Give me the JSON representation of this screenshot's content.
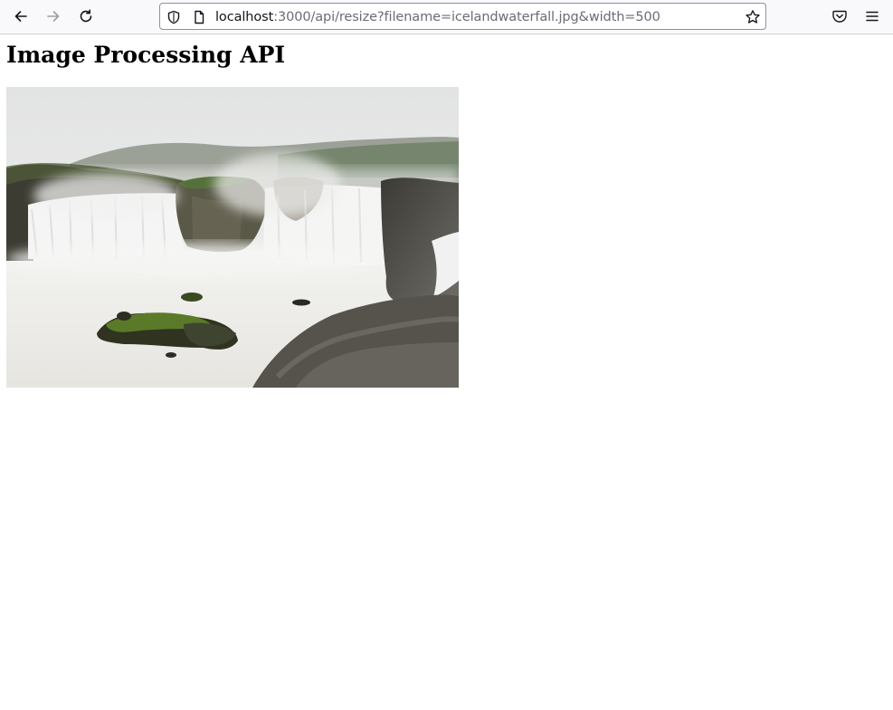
{
  "browser": {
    "url_host": "localhost",
    "url_rest": ":3000/api/resize?filename=icelandwaterfall.jpg&width=500",
    "icons": {
      "back": "arrow-left-icon",
      "forward": "arrow-right-icon",
      "reload": "reload-icon",
      "shield": "shield-icon",
      "page": "page-icon",
      "bookmark": "star-icon",
      "pocket": "pocket-icon",
      "menu": "hamburger-menu-icon"
    }
  },
  "page": {
    "title": "Image Processing API"
  },
  "image": {
    "subject": "icelandic waterfall photo"
  }
}
